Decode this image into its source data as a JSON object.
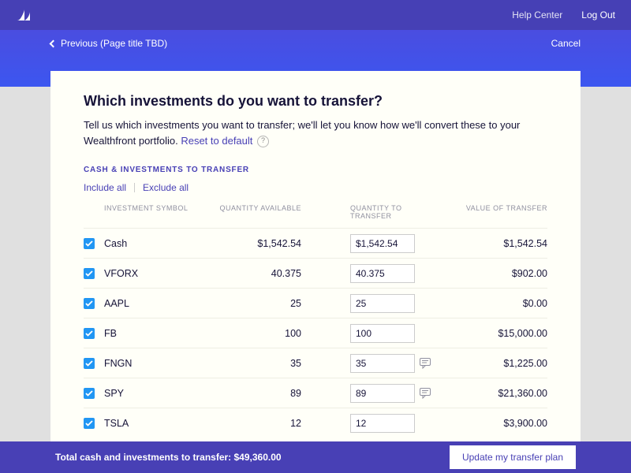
{
  "header": {
    "help_center": "Help Center",
    "log_out": "Log Out"
  },
  "subheader": {
    "back": "Previous (Page title TBD)",
    "cancel": "Cancel"
  },
  "page": {
    "title": "Which investments do you want to transfer?",
    "subtitle_part1": "Tell us which investments you want to transfer; we'll let you know how we'll convert these to your Wealthfront portfolio. ",
    "reset_link": "Reset to default",
    "section_label": "CASH & INVESTMENTS TO TRANSFER",
    "include_all": "Include all",
    "exclude_all": "Exclude all"
  },
  "columns": {
    "symbol": "INVESTMENT SYMBOL",
    "available": "QUANTITY AVAILABLE",
    "to_transfer": "QUANTITY TO TRANSFER",
    "value": "VALUE OF TRANSFER"
  },
  "rows": [
    {
      "symbol": "Cash",
      "available": "$1,542.54",
      "qty": "$1,542.54",
      "note": false,
      "value": "$1,542.54"
    },
    {
      "symbol": "VFORX",
      "available": "40.375",
      "qty": "40.375",
      "note": false,
      "value": "$902.00"
    },
    {
      "symbol": "AAPL",
      "available": "25",
      "qty": "25",
      "note": false,
      "value": "$0.00"
    },
    {
      "symbol": "FB",
      "available": "100",
      "qty": "100",
      "note": false,
      "value": "$15,000.00"
    },
    {
      "symbol": "FNGN",
      "available": "35",
      "qty": "35",
      "note": true,
      "value": "$1,225.00"
    },
    {
      "symbol": "SPY",
      "available": "89",
      "qty": "89",
      "note": true,
      "value": "$21,360.00"
    },
    {
      "symbol": "TSLA",
      "available": "12",
      "qty": "12",
      "note": false,
      "value": "$3,900.00"
    }
  ],
  "footer": {
    "total_label": "Total cash and investments to transfer: ",
    "total_value": "$49,360.00",
    "button": "Update my transfer plan"
  }
}
